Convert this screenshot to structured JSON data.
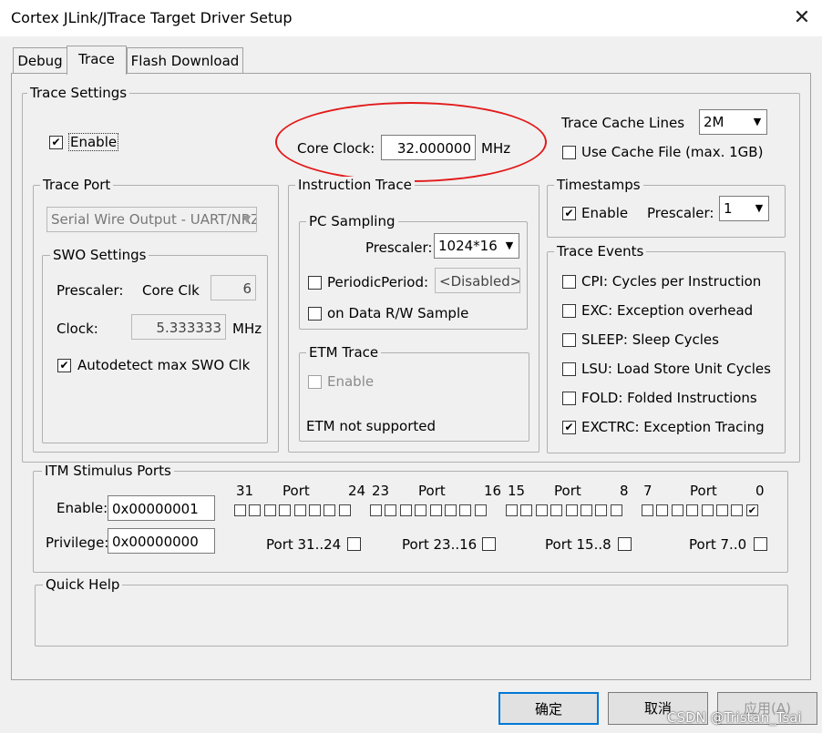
{
  "window": {
    "title": "Cortex JLink/JTrace Target Driver Setup",
    "close_glyph": "✕"
  },
  "tabs": [
    {
      "label": "Debug",
      "active": false
    },
    {
      "label": "Trace",
      "active": true
    },
    {
      "label": "Flash Download",
      "active": false
    }
  ],
  "trace_settings": {
    "group_label": "Trace Settings",
    "enable_label": "Enable",
    "enable_checked": true,
    "core_clock_label": "Core Clock:",
    "core_clock_value": "32.000000",
    "core_clock_unit": "MHz",
    "cache_lines_label": "Trace Cache Lines",
    "cache_lines_value": "2M",
    "use_cache_file_label": "Use Cache File (max. 1GB)",
    "use_cache_file_checked": false
  },
  "trace_port": {
    "group_label": "Trace Port",
    "port_value": "Serial Wire Output - UART/NRZ",
    "swo": {
      "group_label": "SWO Settings",
      "prescaler_label": "Prescaler:",
      "core_clk_label": "Core Clk",
      "prescaler_value": "6",
      "clock_label": "Clock:",
      "clock_value": "5.333333",
      "clock_unit": "MHz",
      "autodetect_label": "Autodetect max SWO Clk",
      "autodetect_checked": true
    }
  },
  "instruction_trace": {
    "group_label": "Instruction Trace",
    "pc_sampling": {
      "group_label": "PC Sampling",
      "prescaler_label": "Prescaler:",
      "prescaler_value": "1024*16",
      "periodic_label": "PeriodicPeriod:",
      "periodic_value": "<Disabled>",
      "data_rw_label": "on Data R/W Sample"
    },
    "etm": {
      "group_label": "ETM Trace",
      "enable_label": "Enable",
      "status": "ETM not supported"
    }
  },
  "timestamps": {
    "group_label": "Timestamps",
    "enable_label": "Enable",
    "enable_checked": true,
    "prescaler_label": "Prescaler:",
    "prescaler_value": "1"
  },
  "trace_events": {
    "group_label": "Trace Events",
    "items": [
      {
        "label": "CPI: Cycles per Instruction",
        "checked": false
      },
      {
        "label": "EXC: Exception overhead",
        "checked": false
      },
      {
        "label": "SLEEP: Sleep Cycles",
        "checked": false
      },
      {
        "label": "LSU: Load Store Unit Cycles",
        "checked": false
      },
      {
        "label": "FOLD: Folded Instructions",
        "checked": false
      },
      {
        "label": "EXCTRC: Exception Tracing",
        "checked": true
      }
    ]
  },
  "itm": {
    "group_label": "ITM Stimulus Ports",
    "enable_label": "Enable:",
    "enable_value": "0x00000001",
    "privilege_label": "Privilege:",
    "privilege_value": "0x00000000",
    "port_word": "Port",
    "blocks": [
      {
        "hi": "31",
        "lo": "24",
        "priv_label": "Port 31..24"
      },
      {
        "hi": "23",
        "lo": "16",
        "priv_label": "Port 23..16"
      },
      {
        "hi": "15",
        "lo": "8",
        "priv_label": "Port 15..8"
      },
      {
        "hi": "7",
        "lo": "0",
        "priv_label": "Port 7..0"
      }
    ],
    "port0_checked": true
  },
  "quick_help": {
    "group_label": "Quick Help"
  },
  "buttons": {
    "ok": "确定",
    "cancel": "取消",
    "apply": "应用(A)"
  },
  "watermark": "CSDN @Tristan_Tsai",
  "colors": {
    "annotation": "#e21a1a",
    "default_button_border": "#0078d7"
  }
}
